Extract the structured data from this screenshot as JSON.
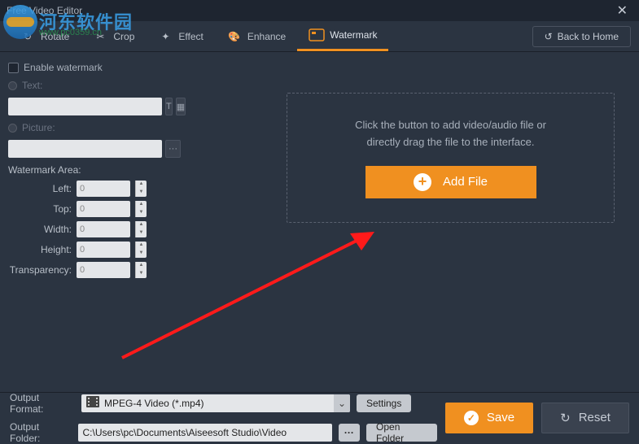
{
  "titlebar": {
    "title": "Free Video Editor"
  },
  "tabs": {
    "rotate": "Rotate",
    "crop": "Crop",
    "effect": "Effect",
    "enhance": "Enhance",
    "watermark": "Watermark"
  },
  "back_home": "Back to Home",
  "panel": {
    "enable_watermark": "Enable watermark",
    "text_label": "Text:",
    "picture_label": "Picture:",
    "area_label": "Watermark Area:",
    "left": "Left:",
    "top": "Top:",
    "width": "Width:",
    "height": "Height:",
    "transparency": "Transparency:",
    "left_val": "0",
    "top_val": "0",
    "width_val": "0",
    "height_val": "0",
    "transparency_val": "0"
  },
  "drop": {
    "line1": "Click the button to add video/audio file or",
    "line2": "directly drag the file to the interface.",
    "add_file": "Add File"
  },
  "bottom": {
    "format_label": "Output Format:",
    "format_value": "MPEG-4 Video (*.mp4)",
    "settings": "Settings",
    "folder_label": "Output Folder:",
    "folder_value": "C:\\Users\\pc\\Documents\\Aiseesoft Studio\\Video",
    "open_folder": "Open Folder",
    "save": "Save",
    "reset": "Reset"
  },
  "overlay_wm": {
    "cn": "河东软件园",
    "url": "www.pc0359.cn"
  }
}
